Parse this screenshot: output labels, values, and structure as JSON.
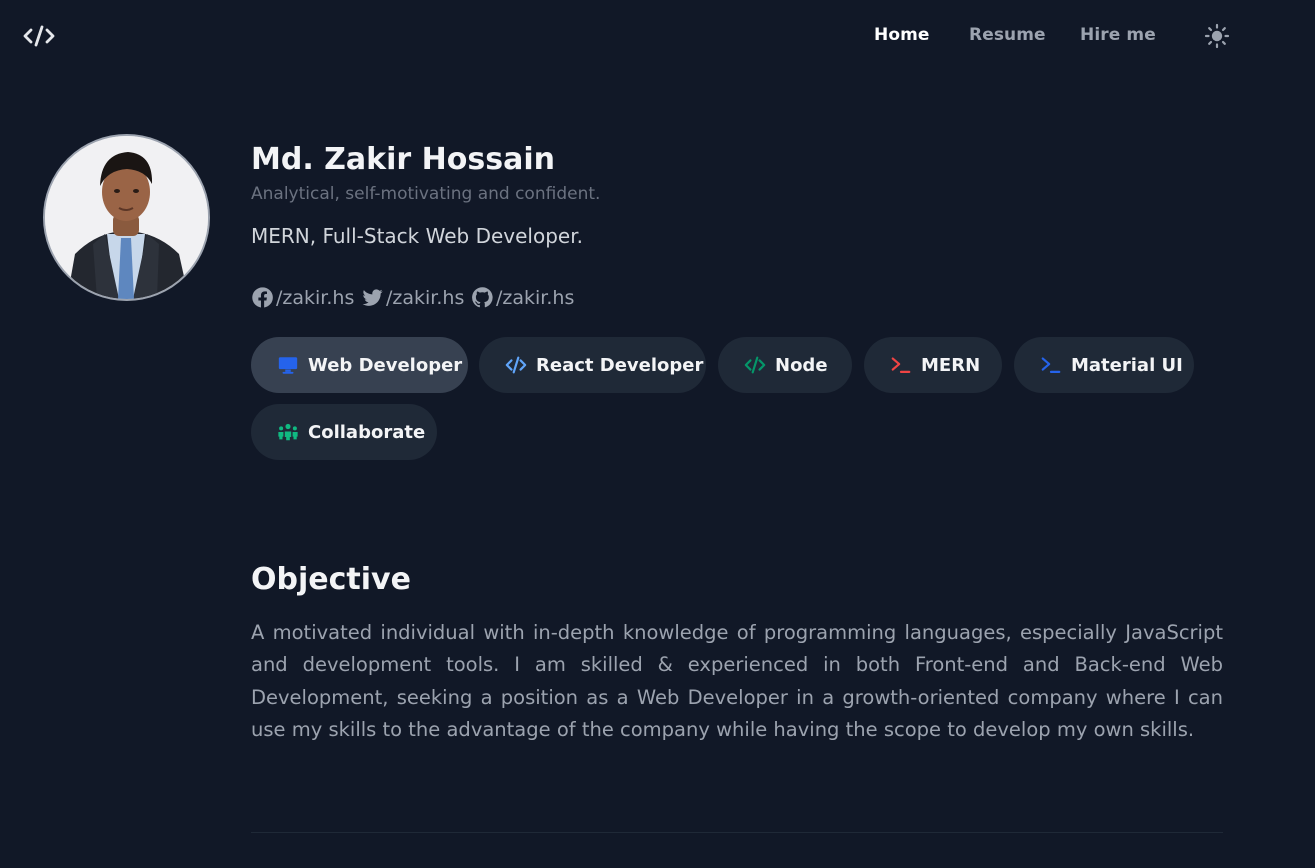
{
  "nav": {
    "logo_icon": "code-brackets-icon",
    "links": [
      {
        "label": "Home",
        "active": true
      },
      {
        "label": "Resume",
        "active": false
      },
      {
        "label": "Hire me",
        "active": false
      }
    ],
    "theme_icon": "sun-icon"
  },
  "profile": {
    "name": "Md. Zakir Hossain",
    "tagline": "Analytical, self-motivating and confident.",
    "role": "MERN, Full-Stack Web Developer.",
    "socials": [
      {
        "icon": "facebook-icon",
        "handle": "/zakir.hs"
      },
      {
        "icon": "twitter-icon",
        "handle": "/zakir.hs"
      },
      {
        "icon": "github-icon",
        "handle": "/zakir.hs"
      }
    ]
  },
  "skills": [
    {
      "label": "Web Developer",
      "icon": "monitor-icon",
      "icon_color": "#2563eb",
      "active": true
    },
    {
      "label": "React Developer",
      "icon": "code-icon",
      "icon_color": "#60a5fa",
      "active": false
    },
    {
      "label": "Node",
      "icon": "code-icon",
      "icon_color": "#059669",
      "active": false
    },
    {
      "label": "MERN",
      "icon": "terminal-icon",
      "icon_color": "#ef4444",
      "active": false
    },
    {
      "label": "Material UI",
      "icon": "terminal-icon",
      "icon_color": "#2563eb",
      "active": false
    },
    {
      "label": "Collaborate",
      "icon": "people-icon",
      "icon_color": "#10b981",
      "active": false
    }
  ],
  "objective": {
    "title": "Objective",
    "text": "A motivated individual with in-depth knowledge of programming languages, especially JavaScript and development tools. I am skilled & experienced in both Front-end and Back-end Web Development, seeking a position as a Web Developer in a growth-oriented company where I can use my skills to the advantage of the company while having the scope to develop my own skills."
  },
  "colors": {
    "background": "#111827",
    "chip_bg": "#1f2937",
    "chip_active_bg": "#374151",
    "muted_text": "#9ca3af"
  }
}
